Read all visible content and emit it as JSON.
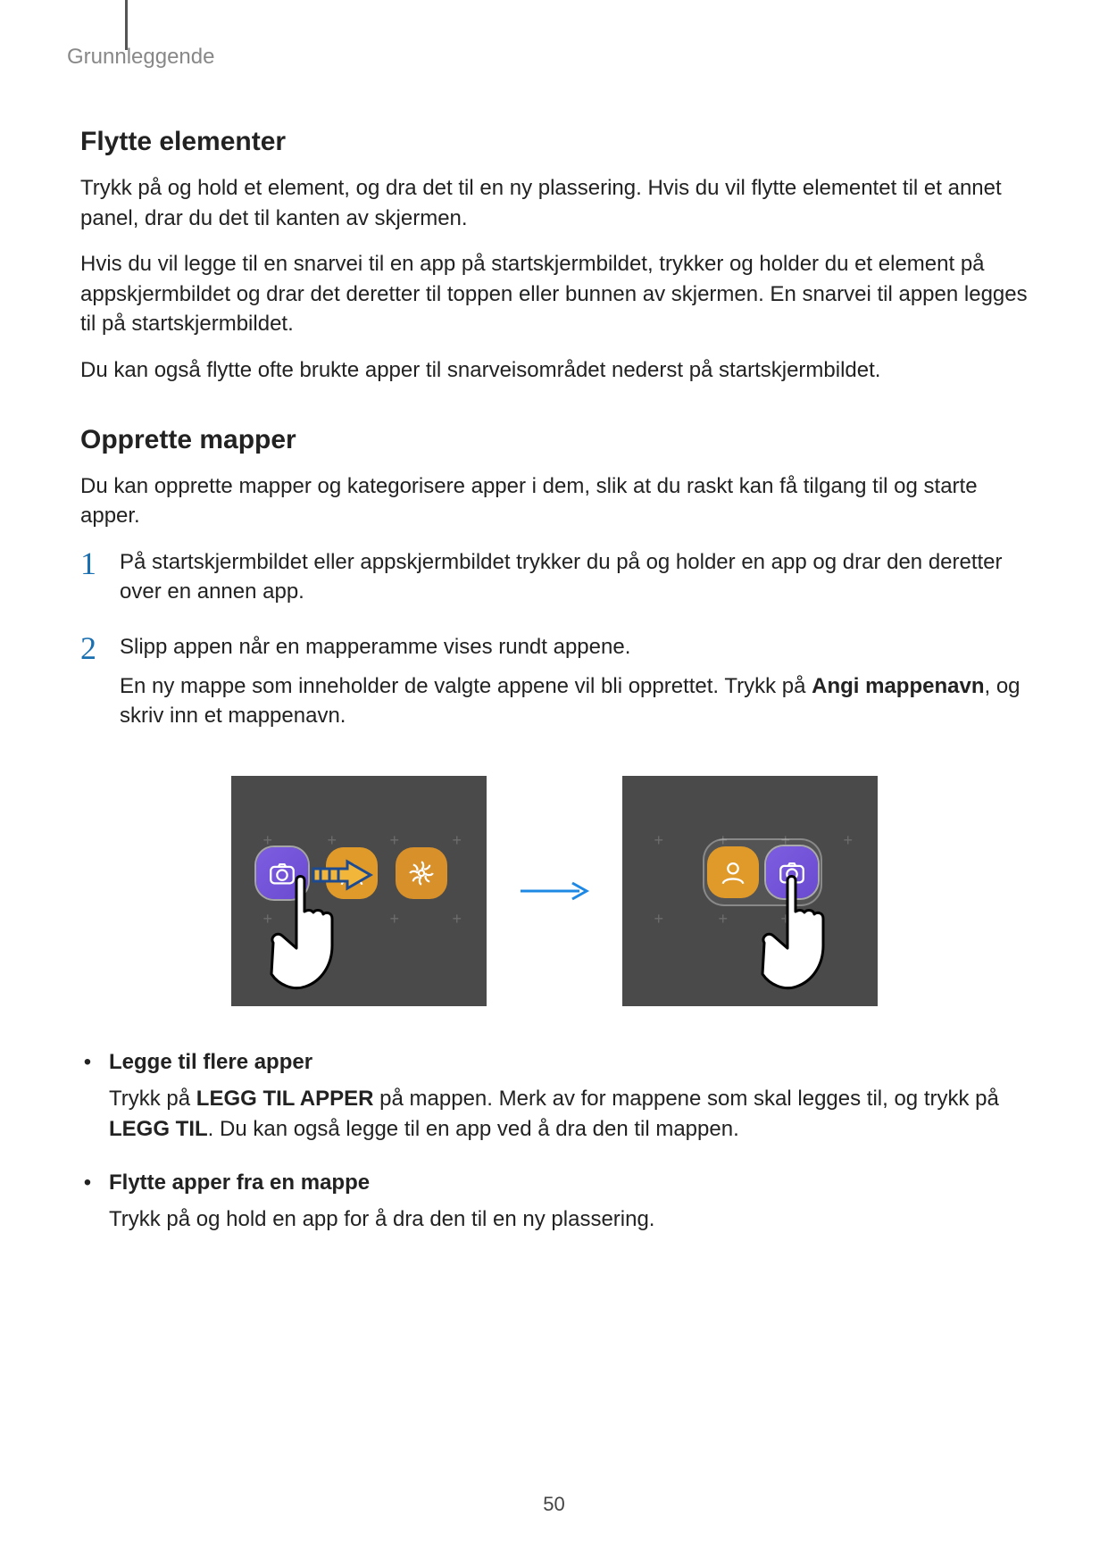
{
  "breadcrumb": "Grunnleggende",
  "h1": "Flytte elementer",
  "p1": "Trykk på og hold et element, og dra det til en ny plassering. Hvis du vil flytte elementet til et annet panel, drar du det til kanten av skjermen.",
  "p2": "Hvis du vil legge til en snarvei til en app på startskjermbildet, trykker og holder du et element på appskjermbildet og drar det deretter til toppen eller bunnen av skjermen. En snarvei til appen legges til på startskjermbildet.",
  "p3": "Du kan også flytte ofte brukte apper til snarveisområdet nederst på startskjermbildet.",
  "h2": "Opprette mapper",
  "p4": "Du kan opprette mapper og kategorisere apper i dem, slik at du raskt kan få tilgang til og starte apper.",
  "step1_num": "1",
  "step1_text": "På startskjermbildet eller appskjermbildet trykker du på og holder en app og drar den deretter over en annen app.",
  "step2_num": "2",
  "step2a": "Slipp appen når en mapperamme vises rundt appene.",
  "step2b_pre": "En ny mappe som inneholder de valgte appene vil bli opprettet. Trykk på ",
  "step2b_bold": "Angi mappenavn",
  "step2b_post": ", og skriv inn et mappenavn.",
  "bullet1_title": "Legge til flere apper",
  "bullet1_pre": "Trykk på ",
  "bullet1_bold1": "LEGG TIL APPER",
  "bullet1_mid": " på mappen. Merk av for mappene som skal legges til, og trykk på ",
  "bullet1_bold2": "LEGG TIL",
  "bullet1_post": ". Du kan også legge til en app ved å dra den til mappen.",
  "bullet2_title": "Flytte apper fra en mappe",
  "bullet2_text": "Trykk på og hold en app for å dra den til en ny plassering.",
  "page_number": "50"
}
